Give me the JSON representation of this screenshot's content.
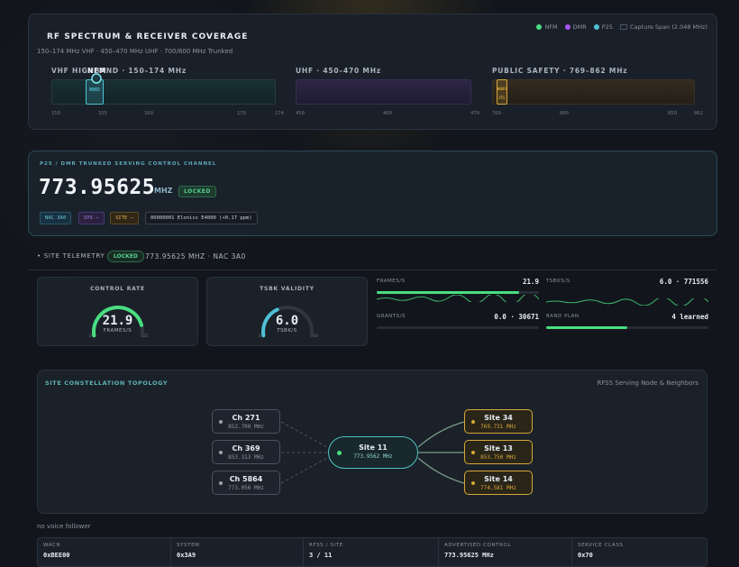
{
  "spectrum": {
    "title": "RF SPECTRUM & RECEIVER COVERAGE",
    "subtitle": "150–174 MHz VHF · 450–470 MHz UHF · 700/800 MHz Trunked",
    "legend": [
      {
        "label": "NFM",
        "color": "#4ade80"
      },
      {
        "label": "DMR",
        "color": "#a855f7"
      },
      {
        "label": "P25",
        "color": "#4fc1d6"
      },
      {
        "label": "Capture Span (2.048 MHz)",
        "color": "#4a5563"
      }
    ],
    "bands": {
      "vhf": {
        "label": "VHF HIGHBAND · 150–174 MHz",
        "overlay": "NFM",
        "ticks": [
          "150",
          "155",
          "160",
          "170",
          "174"
        ],
        "marker": "0002"
      },
      "uhf": {
        "label": "UHF · 450–470 MHz",
        "ticks": [
          "450",
          "460",
          "470"
        ]
      },
      "ps": {
        "label": "PUBLIC SAFETY · 769–862 MHz",
        "ticks": [
          "769",
          "800",
          "850",
          "862"
        ],
        "marker": "0001",
        "marker_sub": "CTL"
      }
    }
  },
  "control": {
    "kicker": "P25 / DMR TRUNKED SERVING CONTROL CHANNEL",
    "frequency": "773.95625",
    "unit": "MHZ",
    "status": "LOCKED",
    "chips": {
      "nac": "NAC 3A0",
      "sys": "SYS —",
      "site": "SITE —",
      "device": "00000001 Elonics E4000 (+0.17 ppm)"
    }
  },
  "telemetry": {
    "label": "• SITE TELEMETRY",
    "status": "LOCKED",
    "summary": "773.95625 MHZ · NAC 3A0",
    "gauges": [
      {
        "title": "CONTROL RATE",
        "value": "21.9",
        "unit": "FRAMES/S",
        "min": "0",
        "max": "25",
        "fraction": 0.876,
        "color": "#4ade80"
      },
      {
        "title": "TSBK VALIDITY",
        "value": "6.0",
        "unit": "TSBK/S",
        "min": "0",
        "max": "16",
        "fraction": 0.375,
        "color": "#4fc1d6"
      }
    ],
    "metrics": {
      "frames": {
        "label": "FRAMES/S",
        "value": "21.9",
        "fill": 0.88
      },
      "tsbks": {
        "label": "TSBKS/S",
        "value": "6.0 · 771556"
      },
      "grants": {
        "label": "GRANTS/S",
        "value": "0.0 · 30671",
        "fill": 0
      },
      "bandplan": {
        "label": "BAND PLAN",
        "value": "4 learned",
        "fill": 0.5
      }
    }
  },
  "topology": {
    "title": "SITE CONSTELLATION TOPOLOGY",
    "subtitle": "RFSS Serving Node & Neighbors",
    "hub": {
      "name": "Site 11",
      "freq": "773.9562 MHz"
    },
    "neighbors": [
      {
        "name": "Ch 271",
        "freq": "852.700 MHz"
      },
      {
        "name": "Ch 369",
        "freq": "853.313 MHz"
      },
      {
        "name": "Ch 5864",
        "freq": "773.056 MHz"
      }
    ],
    "sites": [
      {
        "name": "Site 34",
        "freq": "769.731 MHz"
      },
      {
        "name": "Site 13",
        "freq": "853.750 MHz"
      },
      {
        "name": "Site 14",
        "freq": "774.581 MHz"
      }
    ]
  },
  "footnote": "no voice follower",
  "infobar": [
    {
      "label": "WACN",
      "value": "0xBEE00"
    },
    {
      "label": "SYSTEM",
      "value": "0x3A9"
    },
    {
      "label": "RFSS / SITE",
      "value": "3 / 11"
    },
    {
      "label": "ADVERTISED CONTROL",
      "value": "773.95625 MHz"
    },
    {
      "label": "SERVICE CLASS",
      "value": "0x70"
    }
  ]
}
